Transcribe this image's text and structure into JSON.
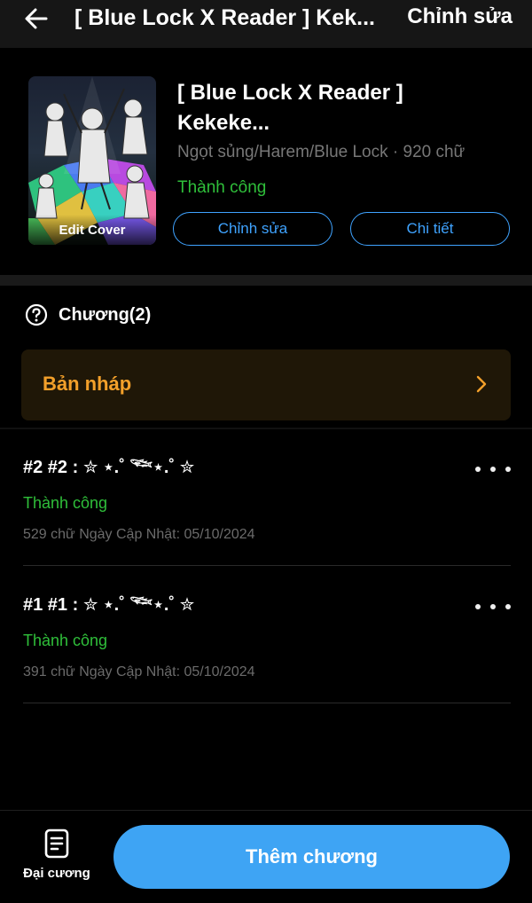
{
  "header": {
    "title": "[ Blue Lock X Reader ] Kek...",
    "edit_label": "Chỉnh sửa"
  },
  "story": {
    "title": "[ Blue Lock X Reader ] Kekeke...",
    "meta": "Ngọt sủng/Harem/Blue Lock · 920 chữ",
    "status": "Thành công",
    "cover_label": "Edit Cover",
    "edit_button": "Chỉnh sửa",
    "detail_button": "Chi tiết"
  },
  "chapters_section": {
    "label": "Chương(2)",
    "draft_label": "Bản nháp"
  },
  "chapters": [
    {
      "title": "#2 #2 : ✮ ⋆.˚ 𓆝⋆.˚ ✮",
      "status": "Thành công",
      "meta": "529 chữ Ngày Cập Nhật: 05/10/2024"
    },
    {
      "title": "#1 #1 : ✮ ⋆.˚ 𓆝⋆.˚ ✮",
      "status": "Thành công",
      "meta": "391 chữ Ngày Cập Nhật: 05/10/2024"
    }
  ],
  "bottom": {
    "outline_label": "Đại cương",
    "add_chapter_label": "Thêm chương"
  },
  "colors": {
    "accent": "#3ea4f4",
    "success": "#2fbf3a",
    "draft": "#f3a02a"
  },
  "icons": {
    "back": "arrow-left-icon",
    "help": "question-circle-icon",
    "chevron": "chevron-right-icon",
    "more": "more-dots-icon",
    "outline": "document-icon"
  }
}
